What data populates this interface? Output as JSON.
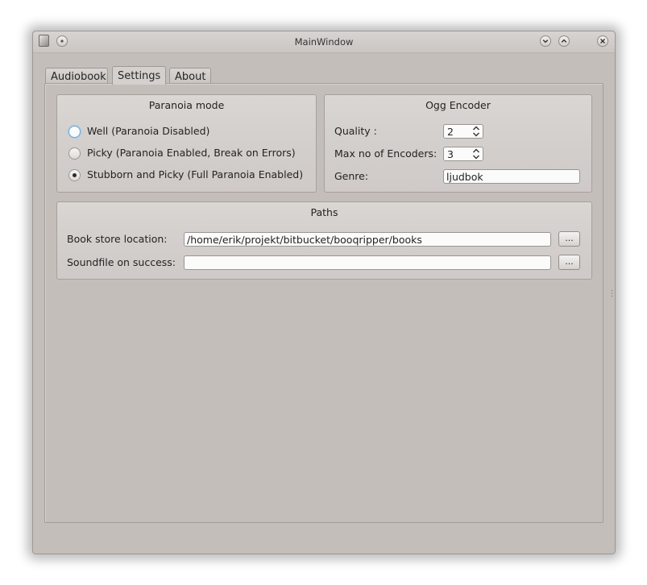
{
  "window": {
    "title": "MainWindow"
  },
  "tabs": [
    {
      "label": "Audiobook",
      "active": false
    },
    {
      "label": "Settings",
      "active": true
    },
    {
      "label": "About",
      "active": false
    }
  ],
  "paranoia": {
    "title": "Paranoia mode",
    "options": [
      {
        "label": "Well (Paranoia Disabled)",
        "checked": false,
        "focused": true
      },
      {
        "label": "Picky (Paranoia Enabled, Break on Errors)",
        "checked": false,
        "focused": false
      },
      {
        "label": "Stubborn and  Picky (Full Paranoia Enabled)",
        "checked": true,
        "focused": false
      }
    ]
  },
  "ogg": {
    "title": "Ogg Encoder",
    "quality_label": "Quality :",
    "quality_value": "2",
    "encoders_label": "Max no of Encoders:",
    "encoders_value": "3",
    "genre_label": "Genre:",
    "genre_value": "ljudbok"
  },
  "paths": {
    "title": "Paths",
    "store_label": "Book store location:",
    "store_value": "/home/erik/projekt/bitbucket/booqripper/books",
    "sound_label": "Soundfile on success:",
    "sound_value": "",
    "browse_label": "..."
  },
  "colors": {
    "window_bg": "#c4bebb",
    "group_bg": "#d4d0cd",
    "focus_ring": "#6fa7cf"
  }
}
